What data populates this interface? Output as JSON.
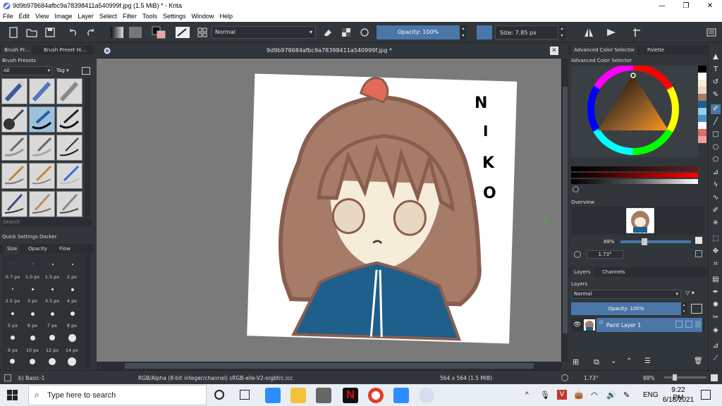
{
  "window": {
    "title": "9d9b978684afbc9a78398411a540999f.jpg (1.5 MiB)  * - Krita",
    "minimize": "—",
    "maximize": "❐",
    "close": "✕"
  },
  "menu": [
    "File",
    "Edit",
    "View",
    "Image",
    "Layer",
    "Select",
    "Filter",
    "Tools",
    "Settings",
    "Window",
    "Help"
  ],
  "toolbar": {
    "blend_mode": "Normal",
    "opacity": "Opacity: 100%",
    "size": "Size: 7.85 px"
  },
  "left_dock": {
    "tabs": [
      "Brush Pr...",
      "Brush Preset Hi..."
    ],
    "title": "Brush Presets",
    "filter": "All",
    "tag": "Tag",
    "search_placeholder": "Search",
    "quick_settings_title": "Quick Settings Docker",
    "qs_tabs": [
      "Size",
      "Opacity",
      "Flow"
    ],
    "sizes": [
      "0.7 px",
      "1.0 px",
      "1.5 px",
      "2 px",
      "2.5 px",
      "3 px",
      "3.5 px",
      "4 px",
      "5 px",
      "6 px",
      "7 px",
      "8 px",
      "9 px",
      "10 px",
      "12 px",
      "14 px"
    ]
  },
  "document": {
    "tab_title": "9d9b978684afbc9a78398411a540999f.jpg *",
    "canvas_text": "NIKO"
  },
  "right_dock": {
    "tabs": [
      "Advanced Color Selector",
      "Palette"
    ],
    "selector_title": "Advanced Color Selector",
    "overview_title": "Overview",
    "zoom": "88%",
    "rotation": "1.73°",
    "layer_tabs": [
      "Layers",
      "Channels"
    ],
    "layers_title": "Layers",
    "layer_blend": "Normal",
    "layer_opacity": "Opacity:  100%",
    "layer_name": "Paint Layer 1"
  },
  "statusbar": {
    "brush": "b) Basic-1",
    "color_space": "RGB/Alpha (8-bit integer/channel)  sRGB-elle-V2-srgbtrc.icc",
    "dimensions": "564 x 564 (1.5 MiB)",
    "rotation": "1.73°",
    "zoom": "88%"
  },
  "taskbar": {
    "search_placeholder": "Type here to search",
    "language": "ENG",
    "time": "9:22 PM",
    "date": "6/18/2021"
  },
  "colors": {
    "hair": "#a67c68",
    "outline": "#8a5e4f",
    "skin": "#f5ecd9",
    "jacket": "#1f5f8b",
    "accent": "#4a76a8"
  }
}
